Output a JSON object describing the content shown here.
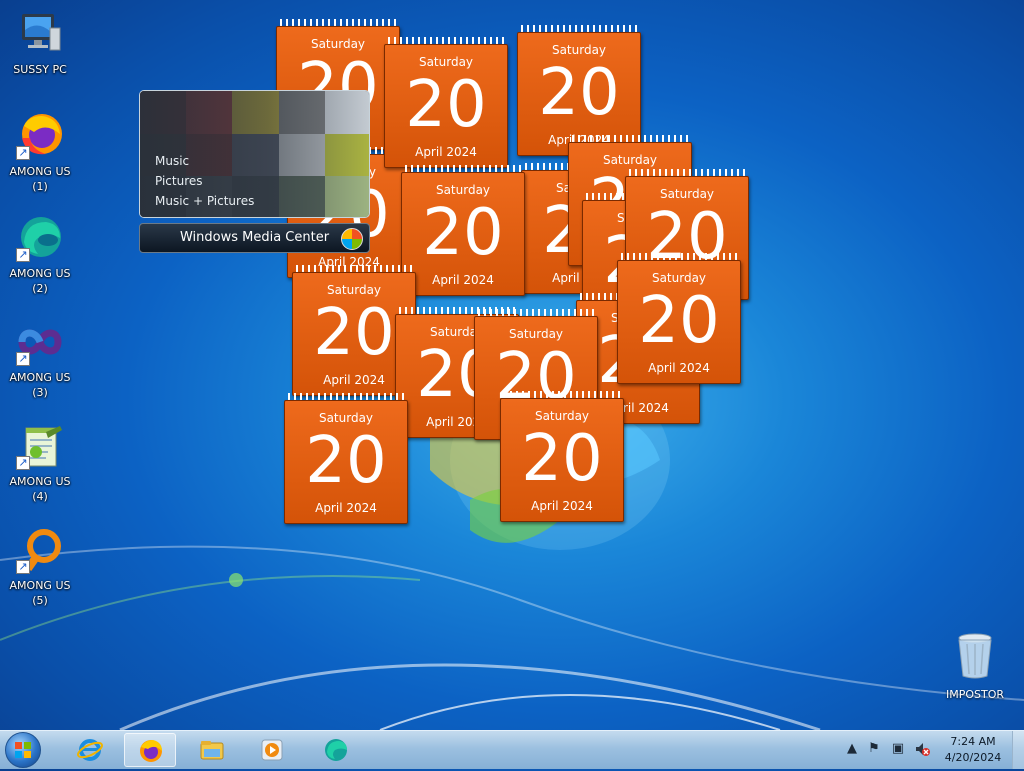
{
  "desktop": {
    "icons": [
      {
        "label": "SUSSY PC",
        "icon": "computer-icon"
      },
      {
        "label": "AMONG US (1)",
        "icon": "firefox-icon"
      },
      {
        "label": "AMONG US (2)",
        "icon": "edge-icon"
      },
      {
        "label": "AMONG US (3)",
        "icon": "visual-studio-icon"
      },
      {
        "label": "AMONG US (4)",
        "icon": "notepad-icon"
      },
      {
        "label": "AMONG US (5)",
        "icon": "ring-app-icon"
      }
    ],
    "recycle_bin": {
      "label": "IMPOSTOR",
      "icon": "recycle-bin-icon"
    }
  },
  "calendar": {
    "day": "Saturday",
    "date": "20",
    "month": "April 2024",
    "color": "#e05f12"
  },
  "media_center": {
    "menu": [
      "Music",
      "Pictures",
      "Music + Pictures"
    ],
    "title": "Windows Media Center"
  },
  "taskbar": {
    "pinned": [
      "start-orb-icon",
      "internet-explorer-icon",
      "firefox-icon",
      "file-explorer-icon",
      "media-player-icon",
      "edge-icon"
    ],
    "tray": [
      "show-hidden-icons",
      "action-center-flag-icon",
      "network-icon",
      "volume-muted-icon"
    ],
    "time": "7:24 AM",
    "date": "4/20/2024"
  }
}
